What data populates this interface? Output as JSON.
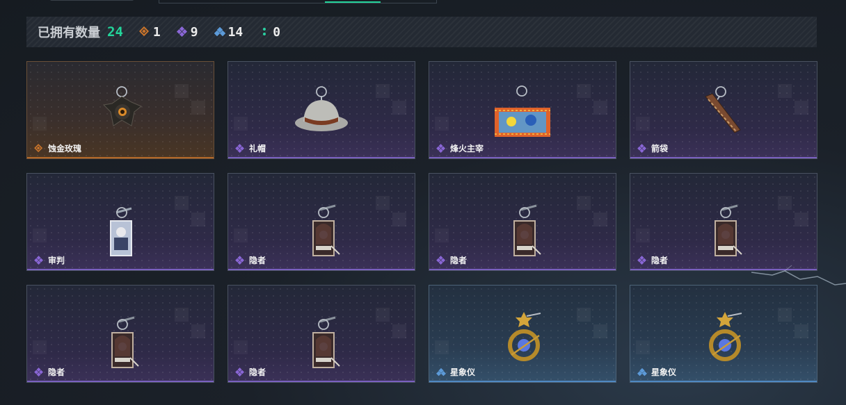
{
  "stats": {
    "label": "已拥有数量",
    "total": "24",
    "counts": [
      {
        "rarity": "gold",
        "icon": "orange-gem-icon",
        "value": "1"
      },
      {
        "rarity": "purple",
        "icon": "purple-diamond-cluster-icon",
        "value": "9"
      },
      {
        "rarity": "blue",
        "icon": "blue-triangle-icon",
        "value": "14"
      },
      {
        "rarity": "green",
        "icon": "green-dots-icon",
        "value": "0"
      }
    ]
  },
  "colors": {
    "accent": "#23d49a",
    "gold": "#c9742b",
    "purple": "#8a67d6",
    "blue": "#5c9ad8",
    "green": "#2ad0a1"
  },
  "items": [
    {
      "name": "蚀金玫瑰",
      "rarity": "gold",
      "art": "rose-pendant"
    },
    {
      "name": "礼帽",
      "rarity": "purple",
      "art": "hat"
    },
    {
      "name": "烽火主宰",
      "rarity": "purple",
      "art": "graffiti-plate"
    },
    {
      "name": "箭袋",
      "rarity": "purple",
      "art": "quiver"
    },
    {
      "name": "审判",
      "rarity": "purple",
      "art": "judge-card"
    },
    {
      "name": "隐者",
      "rarity": "purple",
      "art": "hermit-card"
    },
    {
      "name": "隐者",
      "rarity": "purple",
      "art": "hermit-card"
    },
    {
      "name": "隐者",
      "rarity": "purple",
      "art": "hermit-card"
    },
    {
      "name": "隐者",
      "rarity": "purple",
      "art": "hermit-card"
    },
    {
      "name": "隐者",
      "rarity": "purple",
      "art": "hermit-card"
    },
    {
      "name": "星象仪",
      "rarity": "blue",
      "art": "astrolabe"
    },
    {
      "name": "星象仪",
      "rarity": "blue",
      "art": "astrolabe"
    }
  ]
}
